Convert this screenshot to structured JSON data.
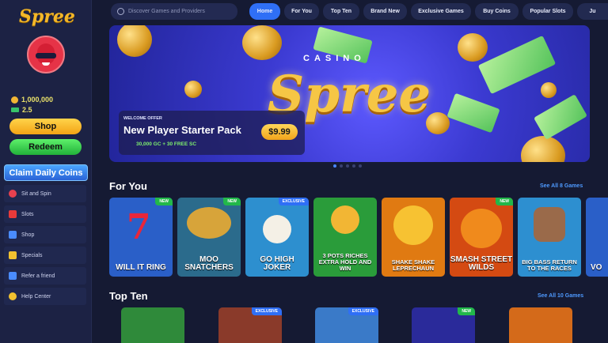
{
  "brand": {
    "name": "Spree"
  },
  "user": {
    "gc_balance": "1,000,000",
    "sc_balance": "2.5"
  },
  "sidebar": {
    "shop_label": "Shop",
    "redeem_label": "Redeem",
    "claim_label": "Claim Daily Coins",
    "items": [
      {
        "label": "Sit and Spin",
        "icon": "wheel-icon",
        "color": "#e8414f"
      },
      {
        "label": "Slots",
        "icon": "seven-icon",
        "color": "#e83a3a"
      },
      {
        "label": "Shop",
        "icon": "cart-icon",
        "color": "#4a8cff"
      },
      {
        "label": "Specials",
        "icon": "star-icon",
        "color": "#f2c230"
      },
      {
        "label": "Refer a friend",
        "icon": "friend-icon",
        "color": "#4a8cff"
      },
      {
        "label": "Help Center",
        "icon": "question-icon",
        "color": "#f2c230"
      }
    ]
  },
  "search": {
    "placeholder": "Discover Games and Providers"
  },
  "nav": [
    "Home",
    "For You",
    "Top Ten",
    "Brand New",
    "Exclusive Games",
    "Buy Coins",
    "Popular Slots",
    "Ju"
  ],
  "banner": {
    "casino_text": "CASINO",
    "spree_text": "Spree",
    "tag": "WELCOME OFFER",
    "title": "New Player Starter Pack",
    "subtitle": "30,000 GC + 30 FREE SC",
    "price": "$9.99"
  },
  "sections": {
    "for_you": {
      "title": "For You",
      "see_all": "See All 8 Games"
    },
    "top_ten": {
      "title": "Top Ten",
      "see_all": "See All 10 Games"
    }
  },
  "for_you_games": [
    {
      "name": "WILL IT RING",
      "badge": "NEW",
      "bg": "#2a5fc8"
    },
    {
      "name": "MOO SNATCHERS",
      "badge": "NEW",
      "bg": "#2b6b8c"
    },
    {
      "name": "GO HIGH JOKER",
      "badge": "EXCLUSIVE",
      "bg": "#2d8fcf"
    },
    {
      "name": "3 POTS RICHES EXTRA HOLD AND WIN",
      "badge": "",
      "bg": "#2a9c3a"
    },
    {
      "name": "SHAKE SHAKE LEPRECHAUN",
      "badge": "",
      "bg": "#e07a12"
    },
    {
      "name": "SMASH STREET WILDS",
      "badge": "NEW",
      "bg": "#d44a12"
    },
    {
      "name": "BIG BASS RETURN TO THE RACES",
      "badge": "",
      "bg": "#2d8fd0"
    },
    {
      "name": "VO",
      "badge": "",
      "bg": "#2a5fc8"
    }
  ],
  "top_ten_games": [
    {
      "badge": "",
      "bg": "#2f8a3a"
    },
    {
      "badge": "EXCLUSIVE",
      "bg": "#8a3a2a"
    },
    {
      "badge": "EXCLUSIVE",
      "bg": "#3a7ac8"
    },
    {
      "badge": "NEW",
      "bg": "#2a2a9a"
    },
    {
      "badge": "",
      "bg": "#d46a1a"
    }
  ]
}
